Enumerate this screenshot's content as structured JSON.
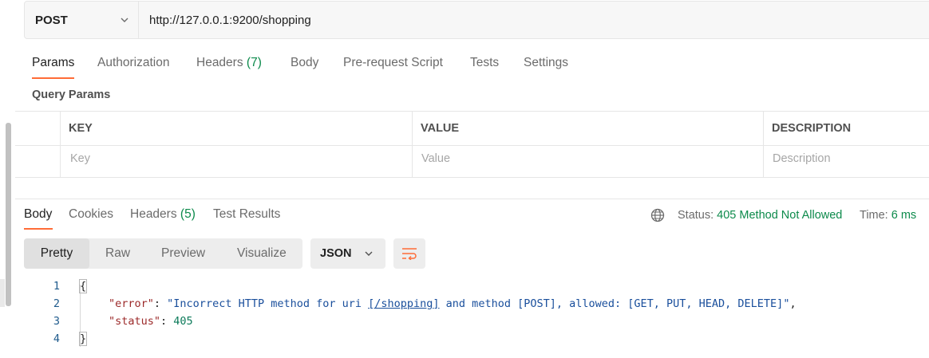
{
  "request": {
    "method": "POST",
    "url": "http://127.0.0.1:9200/shopping"
  },
  "request_tabs": [
    {
      "label": "Params",
      "active": true
    },
    {
      "label": "Authorization"
    },
    {
      "label": "Headers",
      "count": "(7)"
    },
    {
      "label": "Body"
    },
    {
      "label": "Pre-request Script"
    },
    {
      "label": "Tests"
    },
    {
      "label": "Settings"
    }
  ],
  "query_params": {
    "title": "Query Params",
    "columns": [
      "KEY",
      "VALUE",
      "DESCRIPTION"
    ],
    "placeholders": [
      "Key",
      "Value",
      "Description"
    ]
  },
  "response_tabs": [
    {
      "label": "Body",
      "active": true
    },
    {
      "label": "Cookies"
    },
    {
      "label": "Headers",
      "count": "(5)"
    },
    {
      "label": "Test Results"
    }
  ],
  "response_status": {
    "status_label": "Status:",
    "status_value": "405 Method Not Allowed",
    "time_label": "Time:",
    "time_value": "6 ms"
  },
  "view_modes": [
    "Pretty",
    "Raw",
    "Preview",
    "Visualize"
  ],
  "format": "JSON",
  "code": {
    "line_numbers": [
      "1",
      "2",
      "3",
      "4"
    ],
    "open_brace": "{",
    "close_brace": "}",
    "error_key": "\"error\"",
    "error_value_pre": "\"Incorrect HTTP method for uri ",
    "error_value_link": "[/shopping]",
    "error_value_post": " and method [POST], allowed: [GET, PUT, HEAD, DELETE]\"",
    "status_key": "\"status\"",
    "status_value": "405",
    "colon": ": ",
    "comma": ","
  },
  "colors": {
    "accent": "#ff6c37",
    "success": "#0c8a4b"
  },
  "icons": [
    "chevron-down-icon",
    "globe-icon",
    "wrap-lines-icon"
  ]
}
